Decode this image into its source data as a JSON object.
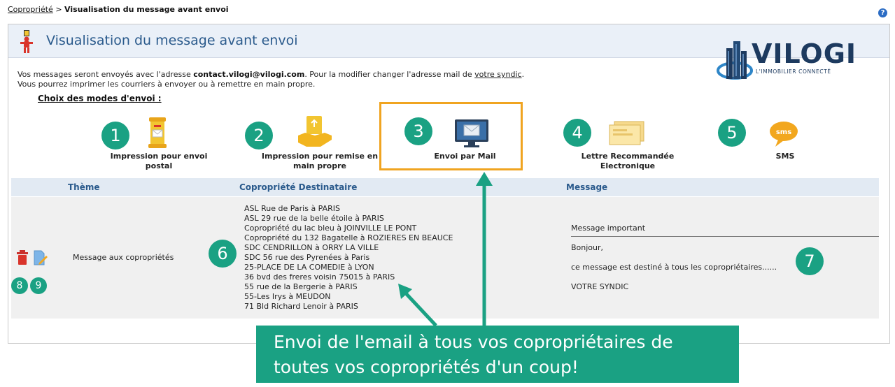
{
  "breadcrumb": {
    "parent": "Copropriété",
    "separator": ">",
    "current": "Visualisation du message avant envoi"
  },
  "help": {
    "label": "?"
  },
  "panel": {
    "title": "Visualisation du message avant envoi"
  },
  "logo": {
    "name": "VILOGI",
    "tagline": "L'IMMOBILIER CONNECTÉ"
  },
  "info": {
    "line1_prefix": "Vos messages seront envoyés avec l'adresse ",
    "email": "contact.vilogi@vilogi.com",
    "line1_suffix": ". Pour la modifier changer l'adresse mail de ",
    "syndic_link": "votre syndic",
    "line1_end": ".",
    "line2": "Vous pourrez imprimer les courriers à envoyer ou à remettre en main propre."
  },
  "modes_title": "Choix des modes d'envoi :",
  "modes": [
    {
      "number": "1",
      "label_line1": "Impression pour envoi",
      "label_line2": "postal",
      "icon": "mailbox-icon"
    },
    {
      "number": "2",
      "label_line1": "Impression pour remise en",
      "label_line2": "main propre",
      "icon": "hand-delivery-icon"
    },
    {
      "number": "3",
      "label_line1": "Envoi par Mail",
      "label_line2": "",
      "icon": "email-monitor-icon",
      "selected": true
    },
    {
      "number": "4",
      "label_line1": "Lettre Recommandée",
      "label_line2": "Electronique",
      "icon": "registered-letter-icon"
    },
    {
      "number": "5",
      "label_line1": "SMS",
      "label_line2": "",
      "icon": "sms-bubble-icon"
    }
  ],
  "table": {
    "headers": {
      "theme": "Thème",
      "copropriete": "Copropriété Destinataire",
      "message": "Message"
    },
    "row": {
      "theme": "Message aux copropriétés",
      "recipients": [
        "ASL Rue de Paris à PARIS",
        "ASL 29 rue de la belle étoile à PARIS",
        "Copropriété du lac bleu à JOINVILLE LE PONT",
        "Copropriété du 132 Bagatelle à ROZIERES EN BEAUCE",
        "SDC CENDRILLON à ORRY LA VILLE",
        "SDC 56 rue des Pyrenées à Paris",
        "25-PLACE DE LA COMEDIE à LYON",
        "36 bvd des freres voisin 75015 à PARIS",
        "55 rue de la Bergerie à PARIS",
        "55-Les Irys à MEUDON",
        "71 Bld Richard Lenoir à PARIS"
      ],
      "message_subject": "Message important",
      "message_body": [
        "Bonjour,",
        "ce message est destiné à tous les copropriétaires......",
        "VOTRE SYNDIC"
      ]
    }
  },
  "annotations": {
    "n6": "6",
    "n7": "7",
    "n8": "8",
    "n9": "9"
  },
  "callout": {
    "line1": "Envoi de l'email à tous vos copropriétaires de",
    "line2": "toutes vos copropriétés d'un coup!"
  },
  "colors": {
    "accent_green": "#1aa183",
    "selection_orange": "#f0a420",
    "header_blue": "#2a5a8c"
  }
}
